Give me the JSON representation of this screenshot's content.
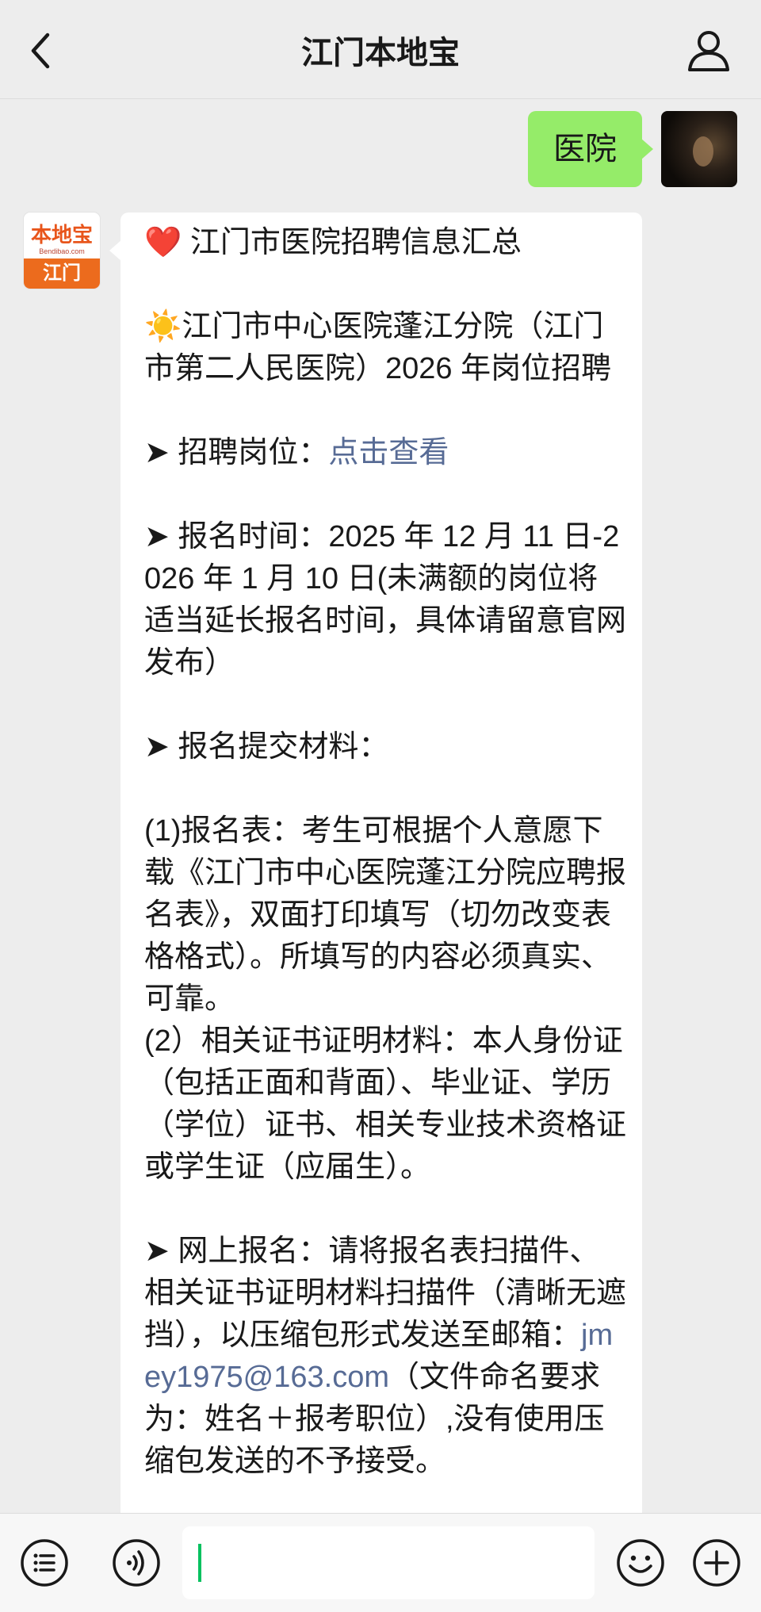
{
  "header": {
    "title": "江门本地宝",
    "back_icon": "chevron-left-icon",
    "profile_icon": "user-icon"
  },
  "messages": {
    "outgoing": {
      "text": "医院"
    },
    "incoming": {
      "avatar_logo_top": "本地宝",
      "avatar_logo_mid": "Bendibao.com",
      "avatar_logo_bottom": "江门",
      "title_emoji": "❤️",
      "title": " 江门市医院招聘信息汇总",
      "section_emoji": "☀️",
      "section_title": "江门市中心医院蓬江分院（江门市第二人民医院）2026 年岗位招聘",
      "positions_prefix": "➤ 招聘岗位：",
      "positions_link": "点击查看",
      "time_text": "➤ 报名时间：2025 年 12 月 11 日-2026 年 1 月 10 日(未满额的岗位将适当延长报名时间，具体请留意官网发布）",
      "materials_title": "➤ 报名提交材料：",
      "materials_1": "(1)报名表：考生可根据个人意愿下载《江门市中心医院蓬江分院应聘报名表》，双面打印填写（切勿改变表格格式）。所填写的内容必须真实、可靠。",
      "materials_2": "(2）相关证书证明材料：本人身份证（包括正面和背面）、毕业证、学历（学位）证书、相关专业技术资格证或学生证（应届生）。",
      "online_prefix": "➤ 网上报名：请将报名表扫描件、相关证书证明材料扫描件（清晰无遮挡），以压缩包形式发送至邮箱：",
      "online_email": "jmey1975@163.com",
      "online_suffix": "（文件命名要求为：姓名＋报考职位）,没有使用压缩包发送的不予接受。"
    }
  },
  "input_bar": {
    "menu_icon": "list-menu-icon",
    "voice_icon": "voice-icon",
    "emoji_icon": "smiley-icon",
    "add_icon": "plus-circle-icon"
  },
  "colors": {
    "background": "#ededed",
    "outgoing_bubble": "#95ec69",
    "link": "#576b95",
    "caret": "#07c160"
  }
}
